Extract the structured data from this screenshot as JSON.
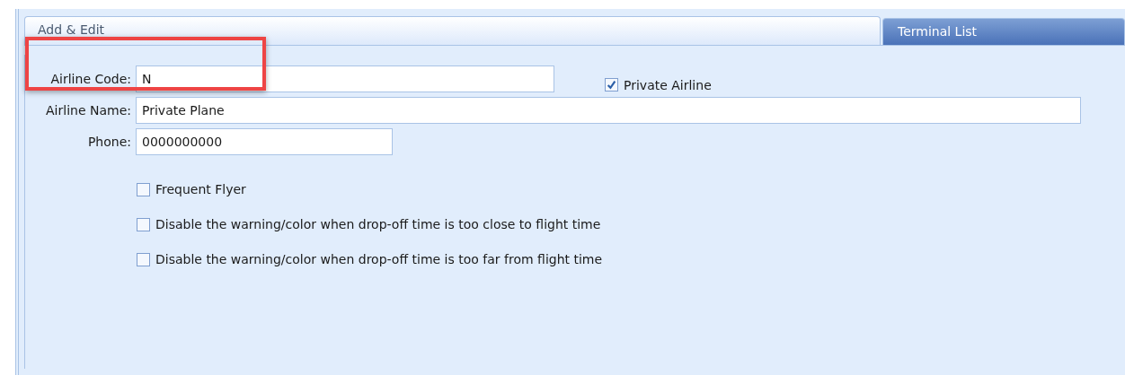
{
  "tabs": [
    {
      "label": "Add & Edit",
      "selected": true
    },
    {
      "label": "Terminal List",
      "selected": false
    }
  ],
  "fields": [
    {
      "label": "Airline Code:",
      "value": "N",
      "highlighted": true,
      "checkbox": {
        "label": "Private Airline",
        "checked": true
      }
    },
    {
      "label": "Airline Name:",
      "value": "Private Plane",
      "highlighted": false
    },
    {
      "label": "Phone:",
      "value": "0000000000",
      "highlighted": false
    }
  ],
  "options": [
    {
      "label": "Frequent Flyer",
      "checked": false
    },
    {
      "label": "Disable the warning/color when drop-off time is too close to flight time",
      "checked": false
    },
    {
      "label": "Disable the warning/color when drop-off time is too far from flight time",
      "checked": false
    }
  ]
}
